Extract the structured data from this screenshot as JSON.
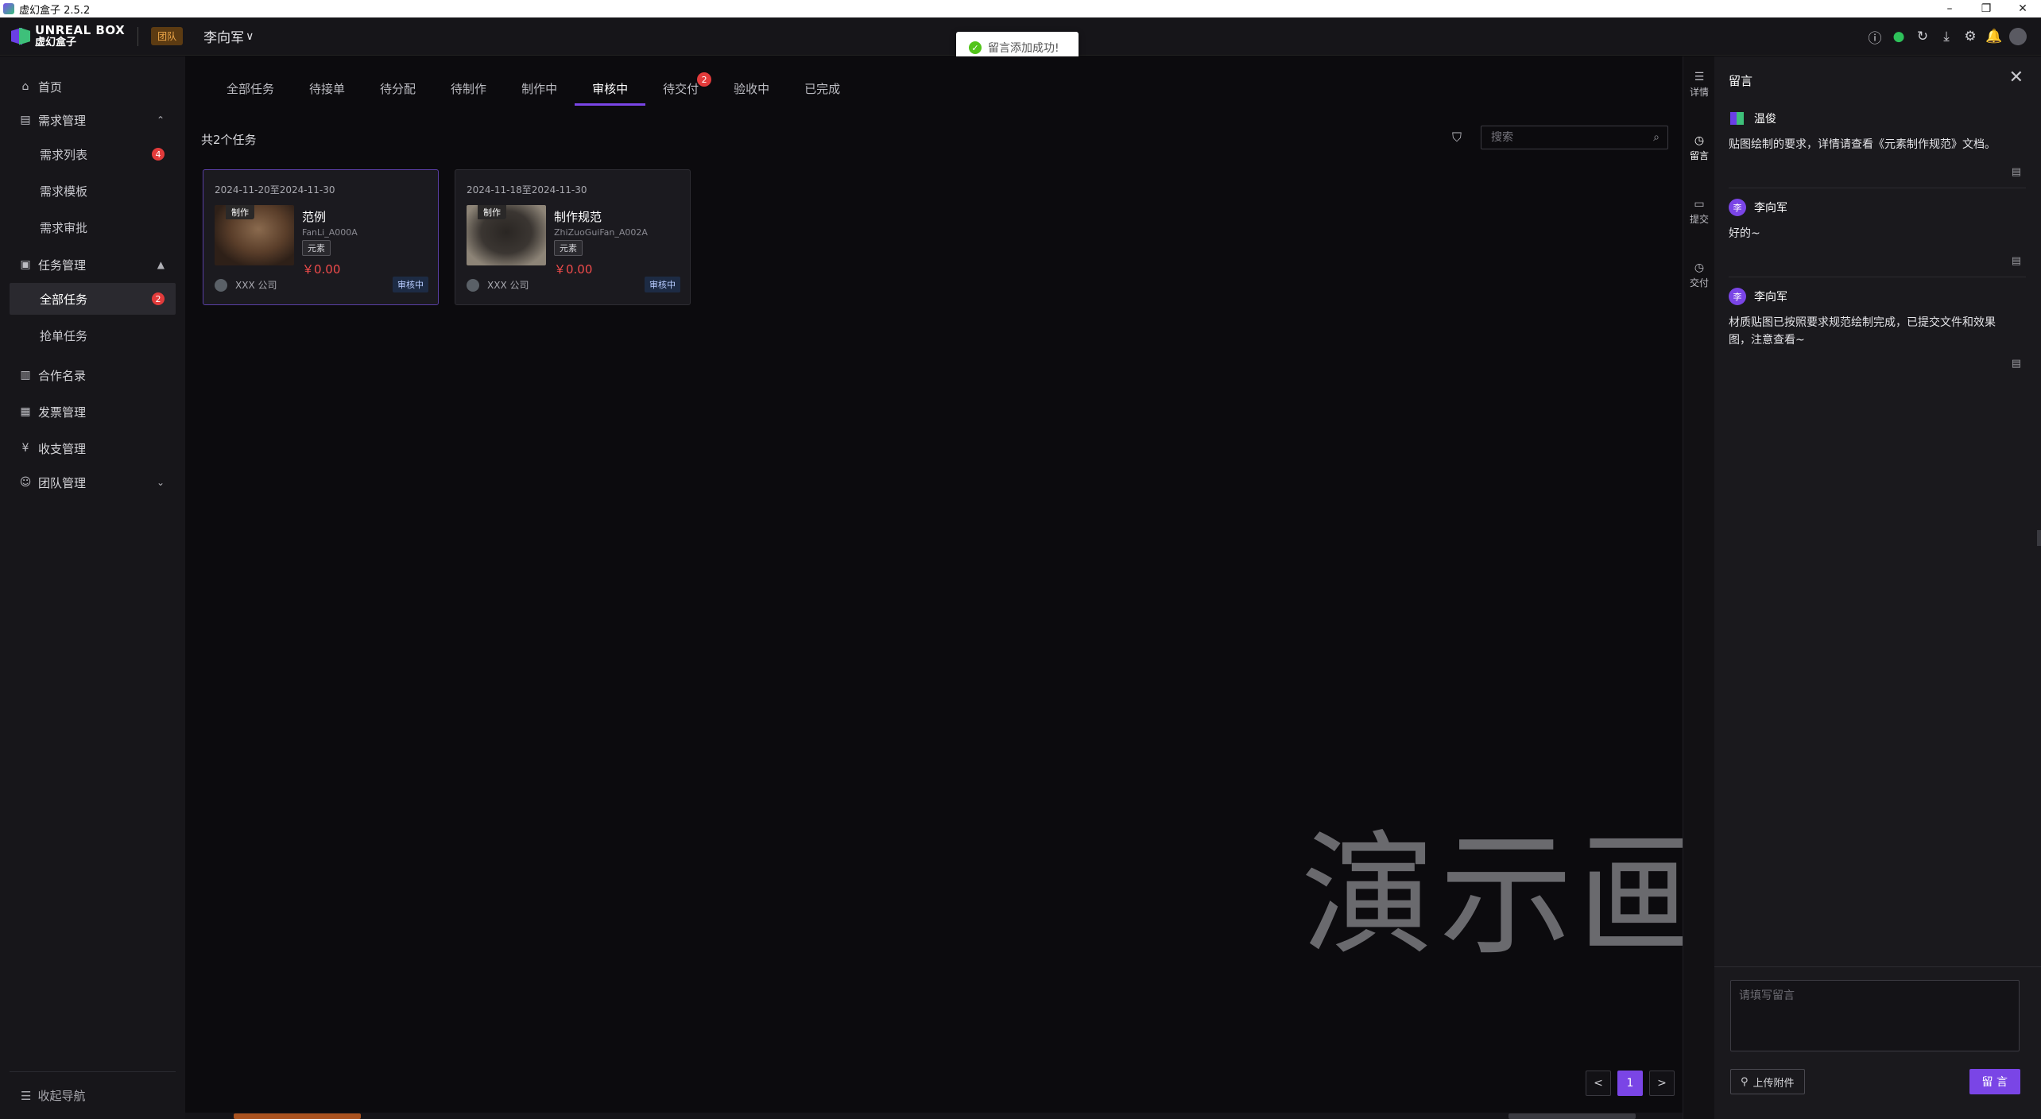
{
  "window": {
    "title": "虚幻盒子 2.5.2",
    "controls": [
      "–",
      "❐",
      "✕"
    ]
  },
  "header": {
    "logo_en": "UNREAL BOX",
    "logo_cn": "虚幻盒子",
    "team_badge": "团队",
    "user_name": "李向军",
    "icons": [
      "help-icon",
      "status-ok-icon",
      "refresh-icon",
      "download-icon",
      "settings-icon",
      "bell-icon",
      "avatar"
    ]
  },
  "toast": {
    "message": "留言添加成功!"
  },
  "sidebar": {
    "items": [
      {
        "label": "首页",
        "icon": "home-icon"
      },
      {
        "label": "需求管理",
        "icon": "table-icon"
      },
      {
        "label": "需求列表",
        "badge": "4"
      },
      {
        "label": "需求模板"
      },
      {
        "label": "需求审批"
      },
      {
        "label": "任务管理",
        "icon": "clipboard-icon"
      },
      {
        "label": "全部任务",
        "badge": "2"
      },
      {
        "label": "抢单任务"
      },
      {
        "label": "合作名录",
        "icon": "book-icon"
      },
      {
        "label": "发票管理",
        "icon": "invoice-icon"
      },
      {
        "label": "收支管理",
        "icon": "money-icon"
      },
      {
        "label": "团队管理",
        "icon": "team-icon"
      }
    ],
    "collapse_label": "收起导航"
  },
  "tabs": [
    {
      "label": "全部任务"
    },
    {
      "label": "待接单"
    },
    {
      "label": "待分配"
    },
    {
      "label": "待制作"
    },
    {
      "label": "制作中"
    },
    {
      "label": "审核中"
    },
    {
      "label": "待交付",
      "badge": "2"
    },
    {
      "label": "验收中"
    },
    {
      "label": "已完成"
    }
  ],
  "list": {
    "count_text": "共2个任务",
    "search_placeholder": "搜索"
  },
  "cards": [
    {
      "date": "2024-11-20至2024-11-30",
      "tag": "制作",
      "name": "范例",
      "code": "FanLi_A000A",
      "type": "元素",
      "price": "￥0.00",
      "company": "XXX 公司",
      "status": "审核中"
    },
    {
      "date": "2024-11-18至2024-11-30",
      "tag": "制作",
      "name": "制作规范",
      "code": "ZhiZuoGuiFan_A002A",
      "type": "元素",
      "price": "￥0.00",
      "company": "XXX 公司",
      "status": "审核中"
    }
  ],
  "watermark": "演示画面",
  "pagination": {
    "prev": "<",
    "current": "1",
    "next": ">"
  },
  "rail": [
    {
      "label": "详情",
      "icon": "list-icon"
    },
    {
      "label": "留言",
      "icon": "clock-icon"
    },
    {
      "label": "提交",
      "icon": "folder-icon"
    },
    {
      "label": "交付",
      "icon": "clock-icon"
    }
  ],
  "comments_panel": {
    "title": "留言",
    "comments": [
      {
        "author": "温俊",
        "avatar": "",
        "text": "贴图绘制的要求，详情请查看《元素制作规范》文档。"
      },
      {
        "author": "李向军",
        "avatar": "李",
        "text": "好的~"
      },
      {
        "author": "李向军",
        "avatar": "李",
        "text": "材质贴图已按照要求规范绘制完成，已提交文件和效果图，注意查看~"
      }
    ],
    "input_placeholder": "请填写留言",
    "upload_label": "上传附件",
    "submit_label": "留 言"
  }
}
